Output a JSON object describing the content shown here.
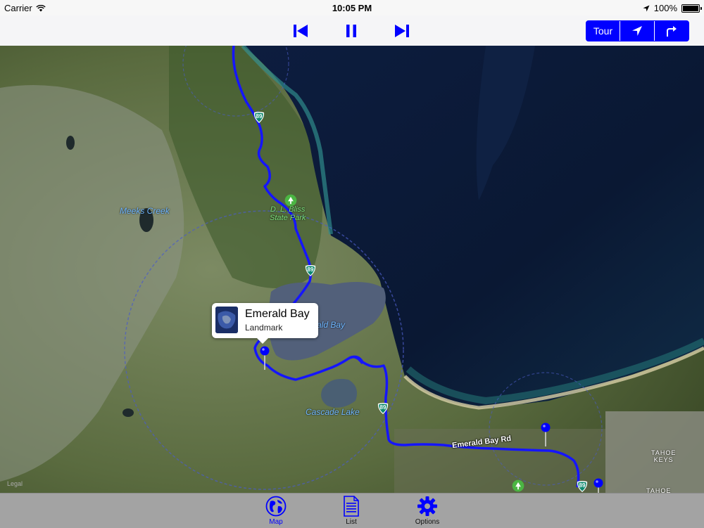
{
  "status_bar": {
    "carrier": "Carrier",
    "time": "10:05 PM",
    "battery": "100%",
    "battery_level": 1.0
  },
  "toolbar": {
    "buttons": [
      {
        "name": "skip-back",
        "icon": "skip-back-icon"
      },
      {
        "name": "pause",
        "icon": "pause-icon"
      },
      {
        "name": "skip-forward",
        "icon": "skip-forward-icon"
      }
    ],
    "segments": [
      {
        "label": "Tour"
      },
      {
        "label": "",
        "icon": "location-arrow-icon"
      },
      {
        "label": "",
        "icon": "turn-right-icon"
      }
    ],
    "accent": "#0000ff"
  },
  "map": {
    "labels": {
      "meeks_creek": "Meeks Creek",
      "dl_bliss_line1": "D. L. Bliss",
      "dl_bliss_line2": "State Park",
      "emerald_bay_partial": "ald Bay",
      "cascade_lake": "Cascade Lake",
      "emerald_bay_rd": "Emerald Bay Rd",
      "tahoe_keys_line1": "TAHOE",
      "tahoe_keys_line2": "KEYS",
      "tahoe_bottom": "TAHOE",
      "legal": "Legal"
    },
    "route_shield": "89",
    "route_color": "#1515ff",
    "callout": {
      "title": "Emerald Bay",
      "subtitle": "Landmark"
    }
  },
  "tab_bar": {
    "items": [
      {
        "label": "Map",
        "icon": "globe-icon",
        "selected": true
      },
      {
        "label": "List",
        "icon": "document-icon",
        "selected": false
      },
      {
        "label": "Options",
        "icon": "gear-icon",
        "selected": false
      }
    ],
    "selected_color": "#0000ff"
  }
}
